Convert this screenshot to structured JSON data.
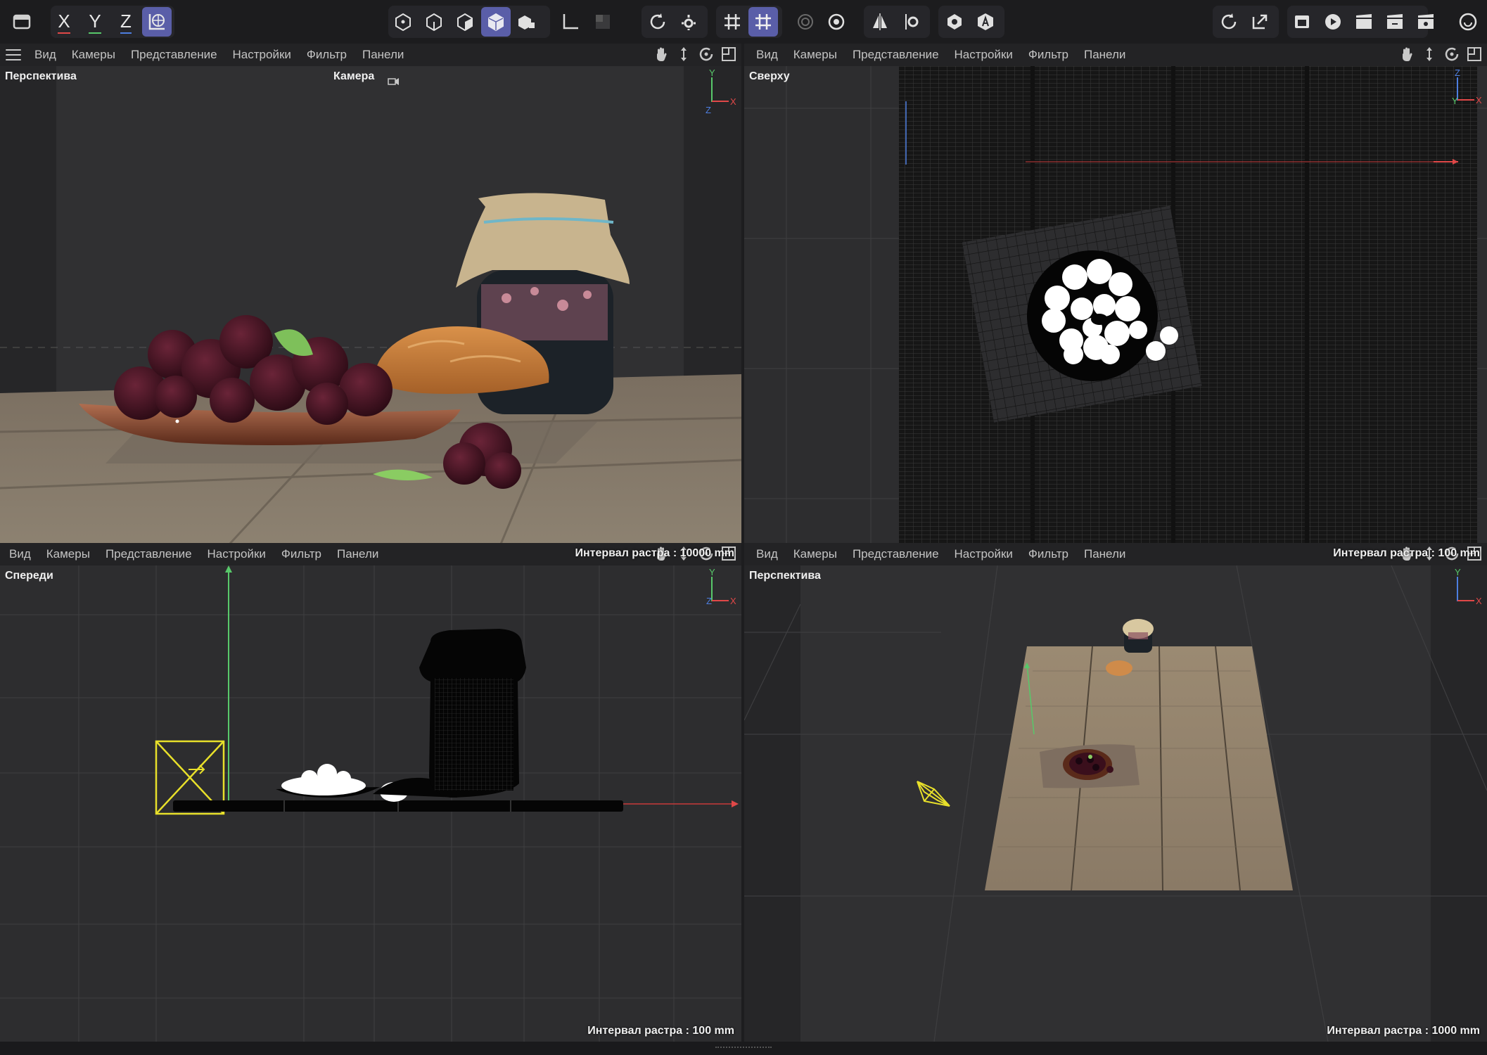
{
  "toolbar": {
    "axis_x": "X",
    "axis_y": "Y",
    "axis_z": "Z",
    "icons": [
      "undo-redo-icon",
      "x-axis-lock",
      "y-axis-lock",
      "z-axis-lock",
      "world-coords-icon",
      "points-mode-icon",
      "edges-mode-icon",
      "polygons-mode-icon",
      "model-mode-icon",
      "object-mode-icon",
      "axis-icon",
      "texture-icon",
      "render-region-icon",
      "render-settings-icon",
      "grid-snap-icon",
      "workplane-snap-icon",
      "soft-select-icon",
      "settings-gear-icon",
      "symmetry-icon",
      "modeling-settings-icon",
      "visibility-icon",
      "ai-icon",
      "refresh-icon",
      "export-icon",
      "render-view-icon",
      "render-picture-viewer-icon",
      "clapper-icon",
      "clapper-edit-icon",
      "clapper-settings-icon",
      "help-icon"
    ]
  },
  "viewport_menu": {
    "view": "Вид",
    "cameras": "Камеры",
    "display": "Представление",
    "options": "Настройки",
    "filter": "Фильтр",
    "panels": "Панели"
  },
  "viewports": {
    "perspective_camera": {
      "title": "Перспектива",
      "camera_label": "Камера",
      "grid_note": "Интервал растра : 10000 mm",
      "gizmo_axes": [
        "Y",
        "X",
        "Z"
      ]
    },
    "top": {
      "title": "Сверху",
      "grid_note": "Интервал растра : 100 mm",
      "gizmo_axes": [
        "Z",
        "Y",
        "X"
      ]
    },
    "front": {
      "title": "Спереди",
      "grid_note": "Интервал растра : 100 mm",
      "gizmo_axes": [
        "Y",
        "Z",
        "X"
      ]
    },
    "perspective": {
      "title": "Перспектива",
      "grid_note": "Интервал растра : 1000 mm",
      "gizmo_axes": [
        "Y",
        "X"
      ]
    }
  },
  "colors": {
    "accent": "#5a5ea8",
    "axis_x": "#e04848",
    "axis_y": "#58c86a",
    "axis_z": "#4d7ee0",
    "camera_yellow": "#e8e02a",
    "viewport_bg": "#2d2d2f"
  }
}
